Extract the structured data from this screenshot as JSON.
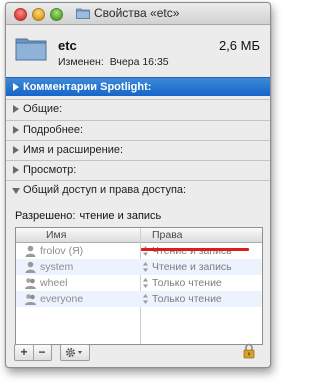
{
  "window": {
    "title": "Свойства «etc»"
  },
  "header": {
    "name": "etc",
    "size": "2,6 МБ",
    "modified_label": "Изменен:",
    "modified_value": "Вчера 16:35"
  },
  "sections": {
    "spotlight": "Комментарии Spotlight:",
    "general": "Общие:",
    "more_info": "Подробнее:",
    "name_ext": "Имя и расширение:",
    "preview": "Просмотр:",
    "sharing": "Общий доступ и права доступа:"
  },
  "sharing": {
    "access_label": "Разрешено:",
    "access_value": "чтение и запись",
    "columns": {
      "name": "Имя",
      "privilege": "Права"
    },
    "rows": [
      {
        "name": "frolov (Я)",
        "privilege": "Чтение и запись",
        "icon": "user-icon"
      },
      {
        "name": "system",
        "privilege": "Чтение и запись",
        "icon": "user-icon"
      },
      {
        "name": "wheel",
        "privilege": "Только чтение",
        "icon": "group-icon"
      },
      {
        "name": "everyone",
        "privilege": "Только чтение",
        "icon": "group-icon"
      }
    ],
    "footer": {
      "add_label": "+",
      "remove_label": "−",
      "gear_icon": "gear-icon",
      "lock_icon": "lock-icon"
    }
  },
  "colors": {
    "selection": "#1665c8",
    "annotation_underline": "#d91e1e"
  }
}
